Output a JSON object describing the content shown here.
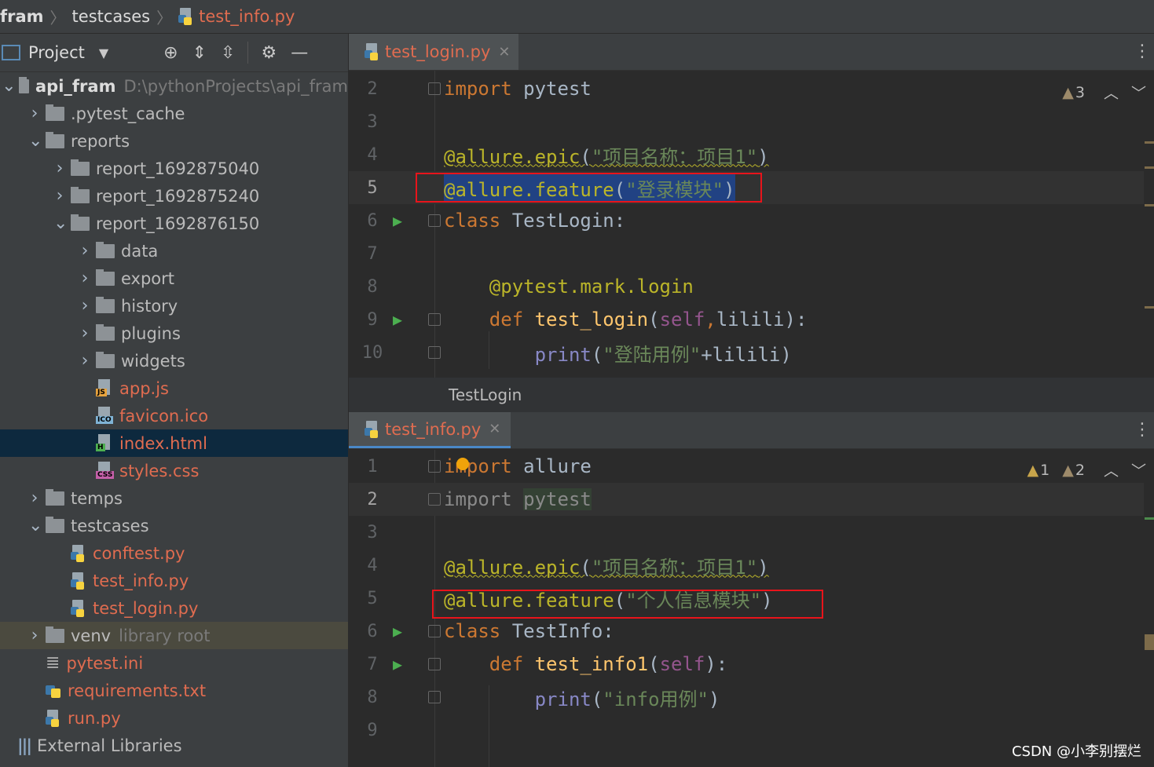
{
  "breadcrumb": {
    "items": [
      "fram",
      "testcases",
      "test_info.py"
    ]
  },
  "project": {
    "title": "Project",
    "tree": [
      {
        "label": "api_fram",
        "extra": "D:\\pythonProjects\\api_fram",
        "type": "folder",
        "arrow": "v",
        "depth": 0
      },
      {
        "label": ".pytest_cache",
        "type": "folder",
        "arrow": ">",
        "depth": 1
      },
      {
        "label": "reports",
        "type": "folder",
        "arrow": "v",
        "depth": 1
      },
      {
        "label": "report_1692875040",
        "type": "folder",
        "arrow": ">",
        "depth": 2
      },
      {
        "label": "report_1692875240",
        "type": "folder",
        "arrow": ">",
        "depth": 2
      },
      {
        "label": "report_1692876150",
        "type": "folder",
        "arrow": "v",
        "depth": 2
      },
      {
        "label": "data",
        "type": "folder",
        "arrow": ">",
        "depth": 3
      },
      {
        "label": "export",
        "type": "folder",
        "arrow": ">",
        "depth": 3
      },
      {
        "label": "history",
        "type": "folder",
        "arrow": ">",
        "depth": 3
      },
      {
        "label": "plugins",
        "type": "folder",
        "arrow": ">",
        "depth": 3
      },
      {
        "label": "widgets",
        "type": "folder",
        "arrow": ">",
        "depth": 3
      },
      {
        "label": "app.js",
        "type": "js",
        "depth": 3
      },
      {
        "label": "favicon.ico",
        "type": "ico",
        "depth": 3
      },
      {
        "label": "index.html",
        "type": "html",
        "depth": 3,
        "selected": true
      },
      {
        "label": "styles.css",
        "type": "css",
        "depth": 3
      },
      {
        "label": "temps",
        "type": "folder",
        "arrow": ">",
        "depth": 1
      },
      {
        "label": "testcases",
        "type": "folder",
        "arrow": "v",
        "depth": 1
      },
      {
        "label": "conftest.py",
        "type": "py",
        "depth": 2
      },
      {
        "label": "test_info.py",
        "type": "py",
        "depth": 2
      },
      {
        "label": "test_login.py",
        "type": "py",
        "depth": 2
      },
      {
        "label": "venv",
        "extra": "library root",
        "type": "folder",
        "arrow": ">",
        "depth": 1,
        "venv": true
      },
      {
        "label": "pytest.ini",
        "type": "ini",
        "depth": 1
      },
      {
        "label": "requirements.txt",
        "type": "txt",
        "depth": 1
      },
      {
        "label": "run.py",
        "type": "py",
        "depth": 1
      },
      {
        "label": "External Libraries",
        "type": "lib",
        "depth": 0
      }
    ]
  },
  "editor_top": {
    "tab": "test_login.py",
    "inspections": {
      "warnings": "3"
    },
    "breadcrumb": "TestLogin",
    "line_numbers": [
      "2",
      "3",
      "4",
      "5",
      "6",
      "7",
      "8",
      "9",
      "10"
    ]
  },
  "editor_bottom": {
    "tab": "test_info.py",
    "inspections": {
      "warnings": "1",
      "weak_warnings": "2"
    },
    "line_numbers": [
      "1",
      "2",
      "3",
      "4",
      "5",
      "6",
      "7",
      "8",
      "9"
    ]
  },
  "code_text": {
    "import_pytest": "import pytest",
    "import_allure": "import allure",
    "epic": "@allure.epic(\"项目名称：项目1\")",
    "feature_login": "@allure.feature(\"登录模块\")",
    "class_login": "class TestLogin:",
    "mark": "@pytest.mark.login",
    "def_login": "def test_login(self,lilili):",
    "print_login": "print(\"登陆用例\"+lilili)",
    "feature_info": "@allure.feature(\"个人信息模块\")",
    "class_info": "class TestInfo:",
    "def_info": "def test_info1(self):",
    "print_info": "print(\"info用例\")"
  },
  "watermark": "CSDN @小李别摆烂",
  "colors": {
    "keyword": "#cc7832",
    "decorator": "#bbb529",
    "string": "#6a8759",
    "function": "#ffc66d",
    "highlight_box": "#e8141b",
    "file_modified": "#e06c50"
  }
}
